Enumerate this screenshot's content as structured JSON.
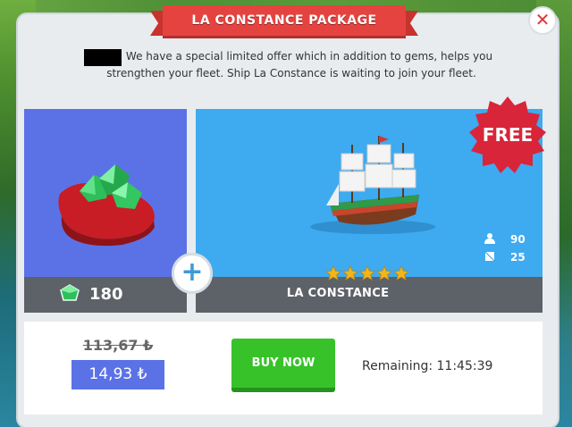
{
  "dialog": {
    "title": "LA CONSTANCE PACKAGE",
    "close_icon": "close-icon",
    "description": "We have a special limited offer which in addition to gems, helps you strengthen your fleet. Ship La Constance is waiting to join your fleet."
  },
  "gems": {
    "amount": "180",
    "icon": "gem-icon"
  },
  "plus_label": "+",
  "ship": {
    "name": "LA CONSTANCE",
    "stars": 5,
    "badge": "FREE",
    "crew": "90",
    "cargo": "25",
    "crew_icon": "person-icon",
    "cargo_icon": "crate-icon"
  },
  "pricing": {
    "old_price": "113,67 ₺",
    "new_price": "14,93 ₺",
    "buy_label": "BUY NOW",
    "remaining": "Remaining: 11:45:39"
  },
  "colors": {
    "ribbon": "#e5433f",
    "gem_panel": "#5b72e6",
    "ship_panel": "#3eaaf0",
    "buy_button": "#38c22a",
    "free_badge": "#d8253a"
  }
}
